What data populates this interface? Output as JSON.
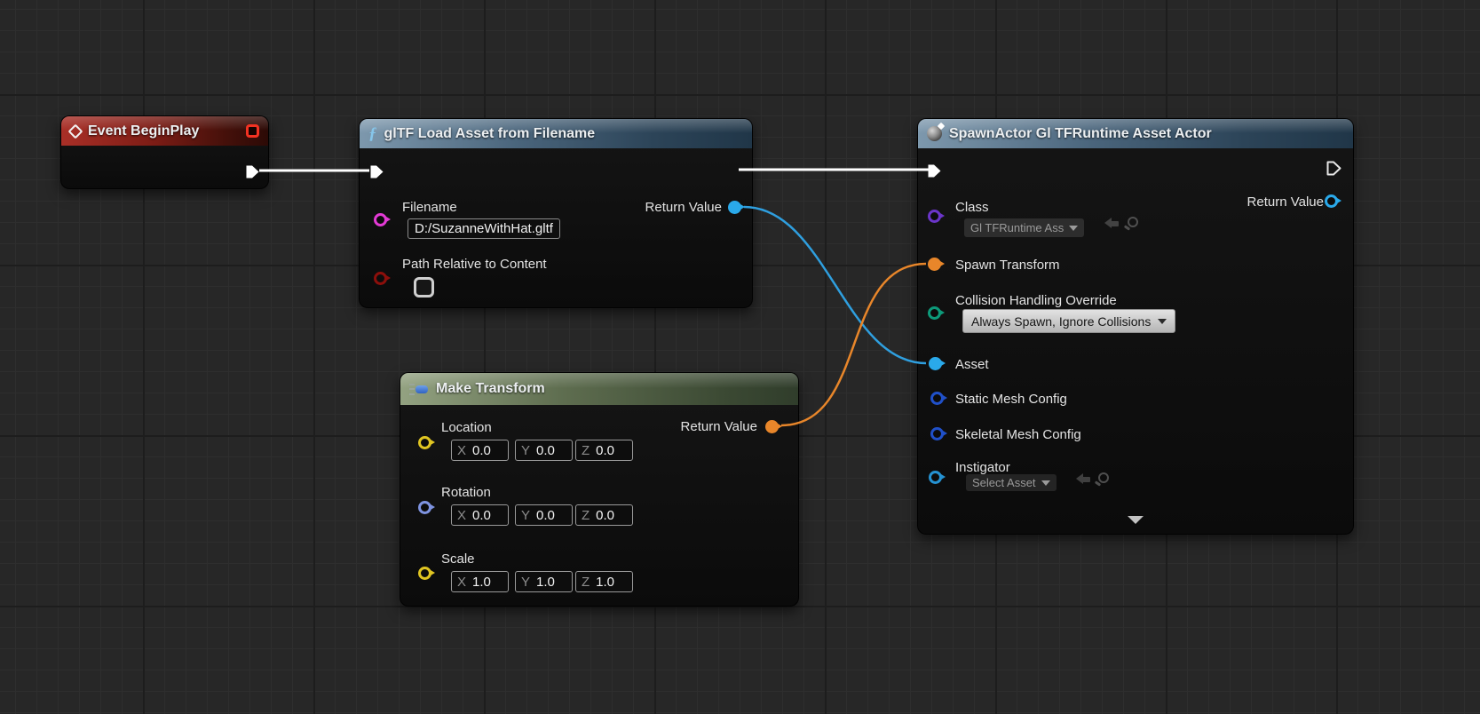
{
  "nodes": {
    "event_begin_play": {
      "title": "Event BeginPlay"
    },
    "gltf_load": {
      "title": "glTF Load Asset from Filename",
      "filename_label": "Filename",
      "filename_value": "D:/SuzanneWithHat.gltf",
      "path_relative_label": "Path Relative to Content",
      "return_value_label": "Return Value"
    },
    "make_transform": {
      "title": "Make Transform",
      "location_label": "Location",
      "rotation_label": "Rotation",
      "scale_label": "Scale",
      "return_value_label": "Return Value",
      "axis_labels": {
        "x": "X",
        "y": "Y",
        "z": "Z"
      },
      "location": {
        "x": "0.0",
        "y": "0.0",
        "z": "0.0"
      },
      "rotation": {
        "x": "0.0",
        "y": "0.0",
        "z": "0.0"
      },
      "scale": {
        "x": "1.0",
        "y": "1.0",
        "z": "1.0"
      }
    },
    "spawn_actor": {
      "title": "SpawnActor Gl TFRuntime Asset Actor",
      "class_label": "Class",
      "class_value": "Gl TFRuntime Ass",
      "spawn_transform_label": "Spawn Transform",
      "collision_label": "Collision Handling Override",
      "collision_value": "Always Spawn, Ignore Collisions",
      "asset_label": "Asset",
      "static_mesh_label": "Static Mesh Config",
      "skeletal_mesh_label": "Skeletal Mesh Config",
      "instigator_label": "Instigator",
      "instigator_value": "Select Asset",
      "return_value_label": "Return Value"
    }
  },
  "colors": {
    "exec_wire": "#ffffff",
    "object_wire": "#2f9fdf",
    "transform_wire": "#e8862a",
    "string_pin": "#e33ad5",
    "bool_pin": "#8c0f0b",
    "class_pin": "#6b35c9",
    "enum_pin": "#0d9a7a",
    "object_pin": "#2aa9ea",
    "struct_pin_blue": "#2050c8",
    "vector_pin": "#e0c522",
    "rotator_pin": "#7e93e0",
    "instigator_pin": "#2592d2"
  }
}
